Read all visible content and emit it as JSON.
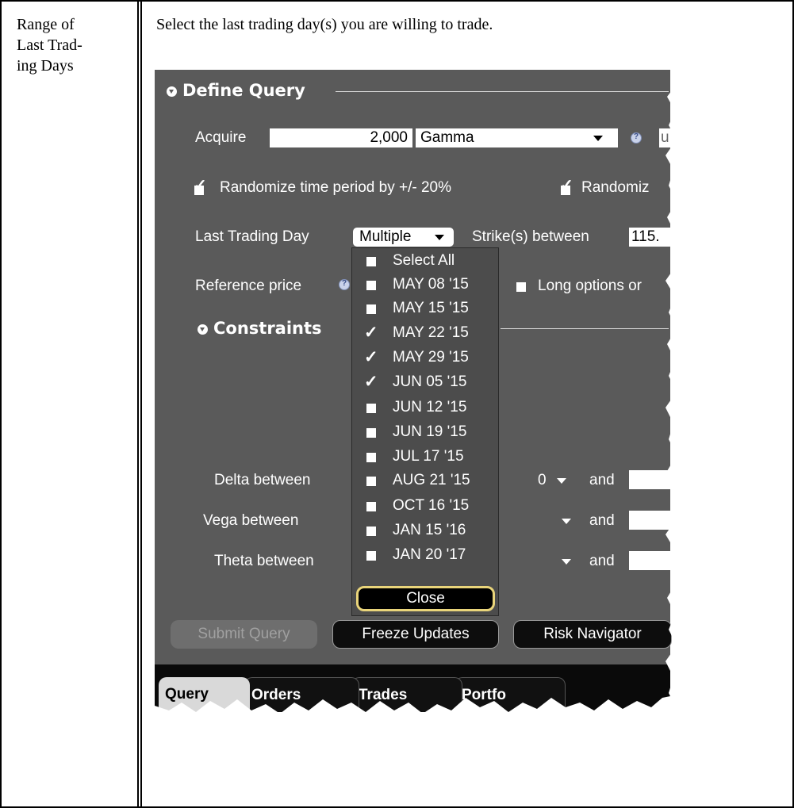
{
  "left_label": "Range of\nLast Trad-\ning Days",
  "description": "Select the last trading day(s) you are willing to trade.",
  "define_query": {
    "title": "Define Query",
    "acquire_label": "Acquire",
    "acquire_value": "2,000",
    "acquire_measure": "Gamma",
    "acquire_cut": "u",
    "randomize_time_label": "Randomize time period by +/- 20%",
    "randomize_cut_label": "Randomiz",
    "last_trading_day_label": "Last Trading Day",
    "last_trading_day_value": "Multiple",
    "strikes_label": "Strike(s) between",
    "strikes_value": "115.",
    "reference_price_label": "Reference price",
    "long_options_label": "Long options or"
  },
  "constraints": {
    "title": "Constraints",
    "delta_label": "Delta between",
    "delta_value": "0",
    "vega_label": "Vega between",
    "theta_label": "Theta between",
    "and_label": "and"
  },
  "popup": {
    "items": [
      {
        "label": "Select All",
        "checked": false
      },
      {
        "label": "MAY 08 '15",
        "checked": false
      },
      {
        "label": "MAY 15 '15",
        "checked": false
      },
      {
        "label": "MAY 22 '15",
        "checked": true
      },
      {
        "label": "MAY 29 '15",
        "checked": true
      },
      {
        "label": "JUN 05 '15",
        "checked": true
      },
      {
        "label": "JUN 12 '15",
        "checked": false
      },
      {
        "label": "JUN 19 '15",
        "checked": false
      },
      {
        "label": "JUL 17 '15",
        "checked": false
      },
      {
        "label": "AUG 21 '15",
        "checked": false
      },
      {
        "label": "OCT 16 '15",
        "checked": false
      },
      {
        "label": "JAN 15 '16",
        "checked": false
      },
      {
        "label": "JAN 20 '17",
        "checked": false
      }
    ],
    "close_label": "Close"
  },
  "buttons": {
    "submit_query": "Submit Query",
    "freeze_updates": "Freeze Updates",
    "risk_navigator": "Risk Navigator"
  },
  "tabs": [
    "Query",
    "Orders",
    "Trades",
    "Portfo"
  ],
  "colors": {
    "panel_bg": "#5a5a5a",
    "close_border": "#e9d47a"
  }
}
